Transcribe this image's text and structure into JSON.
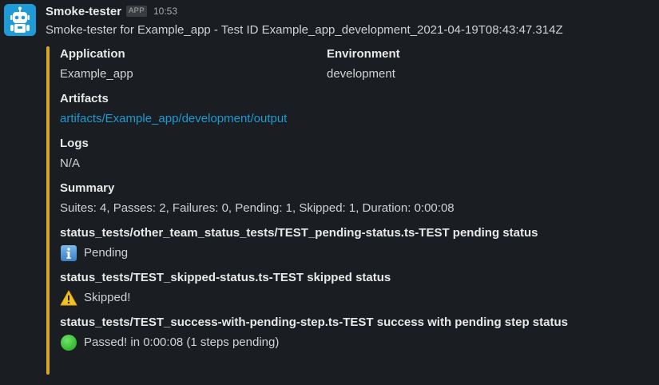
{
  "message": {
    "sender": "Smoke-tester",
    "badge": "APP",
    "time": "10:53",
    "text": "Smoke-tester for Example_app - Test ID Example_app_development_2021-04-19T08:43:47.314Z",
    "accent_color": "#d4a72c",
    "avatar_icon": "robot-icon"
  },
  "fields": {
    "application": {
      "title": "Application",
      "value": "Example_app"
    },
    "environment": {
      "title": "Environment",
      "value": "development"
    },
    "artifacts": {
      "title": "Artifacts",
      "value": "artifacts/Example_app/development/output"
    },
    "logs": {
      "title": "Logs",
      "value": "N/A"
    },
    "summary": {
      "title": "Summary",
      "value": "Suites: 4, Passes: 2, Failures: 0, Pending: 1, Skipped: 1, Duration: 0:00:08"
    }
  },
  "tests": [
    {
      "title": "status_tests/other_team_status_tests/TEST_pending-status.ts-TEST pending status",
      "status": "Pending",
      "icon": "information-icon"
    },
    {
      "title": "status_tests/TEST_skipped-status.ts-TEST skipped status",
      "status": "Skipped!",
      "icon": "warning-icon"
    },
    {
      "title": "status_tests/TEST_success-with-pending-step.ts-TEST success with pending step status",
      "status": "Passed! in 0:00:08 (1 steps pending)",
      "icon": "green-circle-icon"
    }
  ]
}
